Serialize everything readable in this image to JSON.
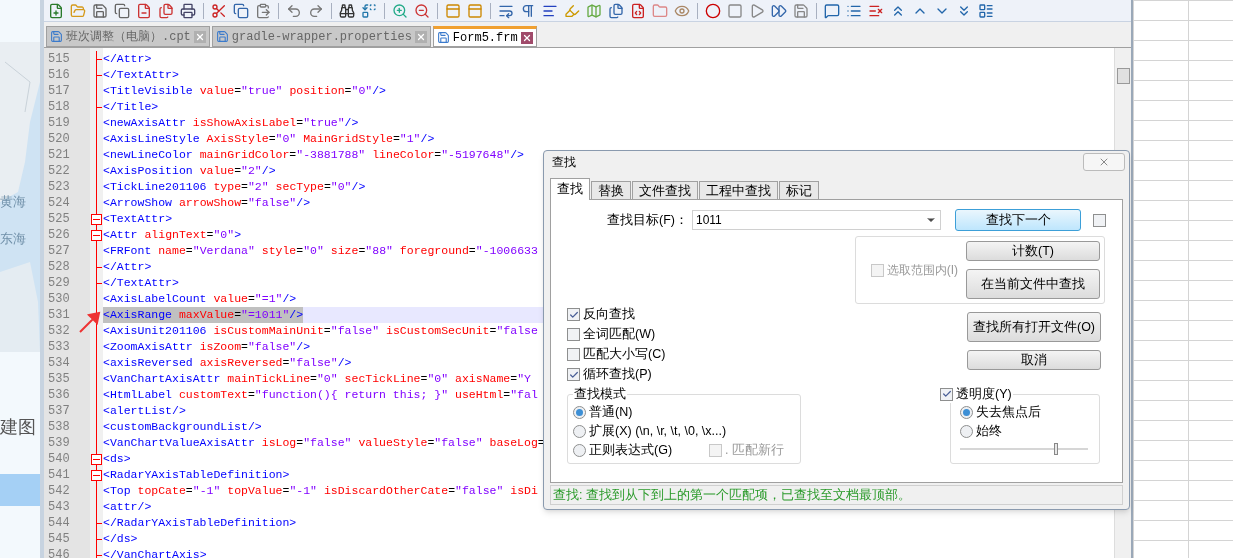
{
  "background_app": {
    "labels": [
      "黄海",
      "东海",
      "建图"
    ]
  },
  "tabs": [
    {
      "label": "班次调整（电脑）.cpt",
      "selected": false
    },
    {
      "label": "gradle-wrapper.properties",
      "selected": false
    },
    {
      "label": "Form5.frm",
      "selected": true
    }
  ],
  "editor": {
    "lines": [
      {
        "number": "515",
        "kind": "end",
        "selected": false,
        "text": "</Attr>"
      },
      {
        "number": "516",
        "kind": "end",
        "selected": false,
        "text": "</TextAttr>"
      },
      {
        "number": "517",
        "kind": "line",
        "selected": false,
        "text": "<TitleVisible value=\"true\" position=\"0\"/>"
      },
      {
        "number": "518",
        "kind": "end",
        "selected": false,
        "text": "</Title>"
      },
      {
        "number": "519",
        "kind": "line",
        "selected": false,
        "text": "<newAxisAttr isShowAxisLabel=\"true\"/>"
      },
      {
        "number": "520",
        "kind": "line",
        "selected": false,
        "text": "<AxisLineStyle AxisStyle=\"0\" MainGridStyle=\"1\"/>"
      },
      {
        "number": "521",
        "kind": "line",
        "selected": false,
        "text": "<newLineColor mainGridColor=\"-3881788\" lineColor=\"-5197648\"/>"
      },
      {
        "number": "522",
        "kind": "line",
        "selected": false,
        "text": "<AxisPosition value=\"2\"/>"
      },
      {
        "number": "523",
        "kind": "line",
        "selected": false,
        "text": "<TickLine201106 type=\"2\" secType=\"0\"/>"
      },
      {
        "number": "524",
        "kind": "line",
        "selected": false,
        "text": "<ArrowShow arrowShow=\"false\"/>"
      },
      {
        "number": "525",
        "kind": "fold",
        "selected": false,
        "text": "<TextAttr>"
      },
      {
        "number": "526",
        "kind": "fold",
        "selected": false,
        "text": "<Attr alignText=\"0\">"
      },
      {
        "number": "527",
        "kind": "line",
        "selected": false,
        "text": "<FRFont name=\"Verdana\" style=\"0\" size=\"88\" foreground=\"-1006633"
      },
      {
        "number": "528",
        "kind": "end",
        "selected": false,
        "text": "</Attr>"
      },
      {
        "number": "529",
        "kind": "end",
        "selected": false,
        "text": "</TextAttr>"
      },
      {
        "number": "530",
        "kind": "line",
        "selected": false,
        "text": "<AxisLabelCount value=\"=1\"/>"
      },
      {
        "number": "531",
        "kind": "line",
        "selected": true,
        "text": "<AxisRange maxValue=\"=1011\"/>"
      },
      {
        "number": "532",
        "kind": "line",
        "selected": false,
        "text": "<AxisUnit201106 isCustomMainUnit=\"false\" isCustomSecUnit=\"false"
      },
      {
        "number": "533",
        "kind": "line",
        "selected": false,
        "text": "<ZoomAxisAttr isZoom=\"false\"/>"
      },
      {
        "number": "534",
        "kind": "line",
        "selected": false,
        "text": "<axisReversed axisReversed=\"false\"/>"
      },
      {
        "number": "535",
        "kind": "line",
        "selected": false,
        "text": "<VanChartAxisAttr mainTickLine=\"0\" secTickLine=\"0\" axisName=\"Y"
      },
      {
        "number": "536",
        "kind": "line",
        "selected": false,
        "text": "<HtmlLabel customText=\"function(){ return this; }\" useHtml=\"fal"
      },
      {
        "number": "537",
        "kind": "line",
        "selected": false,
        "text": "<alertList/>"
      },
      {
        "number": "538",
        "kind": "line",
        "selected": false,
        "text": "<customBackgroundList/>"
      },
      {
        "number": "539",
        "kind": "line",
        "selected": false,
        "text": "<VanChartValueAxisAttr isLog=\"false\" valueStyle=\"false\" baseLog="
      },
      {
        "number": "540",
        "kind": "fold",
        "selected": false,
        "text": "<ds>"
      },
      {
        "number": "541",
        "kind": "fold",
        "selected": false,
        "text": "<RadarYAxisTableDefinition>"
      },
      {
        "number": "542",
        "kind": "line",
        "selected": false,
        "text": "<Top topCate=\"-1\" topValue=\"-1\" isDiscardOtherCate=\"false\" isDi"
      },
      {
        "number": "543",
        "kind": "line",
        "selected": false,
        "text": "<attr/>"
      },
      {
        "number": "544",
        "kind": "end",
        "selected": false,
        "text": "</RadarYAxisTableDefinition>"
      },
      {
        "number": "545",
        "kind": "end",
        "selected": false,
        "text": "</ds>"
      },
      {
        "number": "546",
        "kind": "end",
        "selected": false,
        "text": "</VanChartAxis>"
      }
    ]
  },
  "find_dialog": {
    "title": "查找",
    "tabs": [
      {
        "label": "查找",
        "selected": true
      },
      {
        "label": "替换",
        "selected": false
      },
      {
        "label": "文件查找",
        "selected": false
      },
      {
        "label": "工程中查找",
        "selected": false
      },
      {
        "label": "标记",
        "selected": false
      }
    ],
    "target_label": "查找目标(F)：",
    "target_value": "1011",
    "find_next_extra_checked": false,
    "in_selection": {
      "label": "选取范围内(I)",
      "checked": false,
      "disabled": true
    },
    "buttons": [
      {
        "label": "查找下一个",
        "default": true
      },
      {
        "label": "计数(T)",
        "default": false
      },
      {
        "label": "在当前文件中查找",
        "default": false
      },
      {
        "label": "查找所有打开文件(O)",
        "default": false
      },
      {
        "label": "取消",
        "default": false
      }
    ],
    "options": [
      {
        "label": "反向查找",
        "checked": true
      },
      {
        "label": "全词匹配(W)",
        "checked": false
      },
      {
        "label": "匹配大小写(C)",
        "checked": false
      },
      {
        "label": "循环查找(P)",
        "checked": true
      }
    ],
    "mode": {
      "title": "查找模式",
      "radios": [
        {
          "label": "普通(N)",
          "selected": true
        },
        {
          "label": "扩展(X) (\\n, \\r, \\t, \\0, \\x...)",
          "selected": false
        },
        {
          "label": "正则表达式(G)",
          "selected": false
        }
      ],
      "newline": {
        "label": ". 匹配新行",
        "checked": false,
        "disabled": true
      }
    },
    "transparency": {
      "label": "透明度(Y)",
      "checked": true,
      "radios": [
        {
          "label": "失去焦点后",
          "selected": true
        },
        {
          "label": "始终",
          "selected": false
        }
      ],
      "level": 0.75
    },
    "status": "查找: 查找到从下到上的第一个匹配项，已查找至文档最顶部。"
  }
}
